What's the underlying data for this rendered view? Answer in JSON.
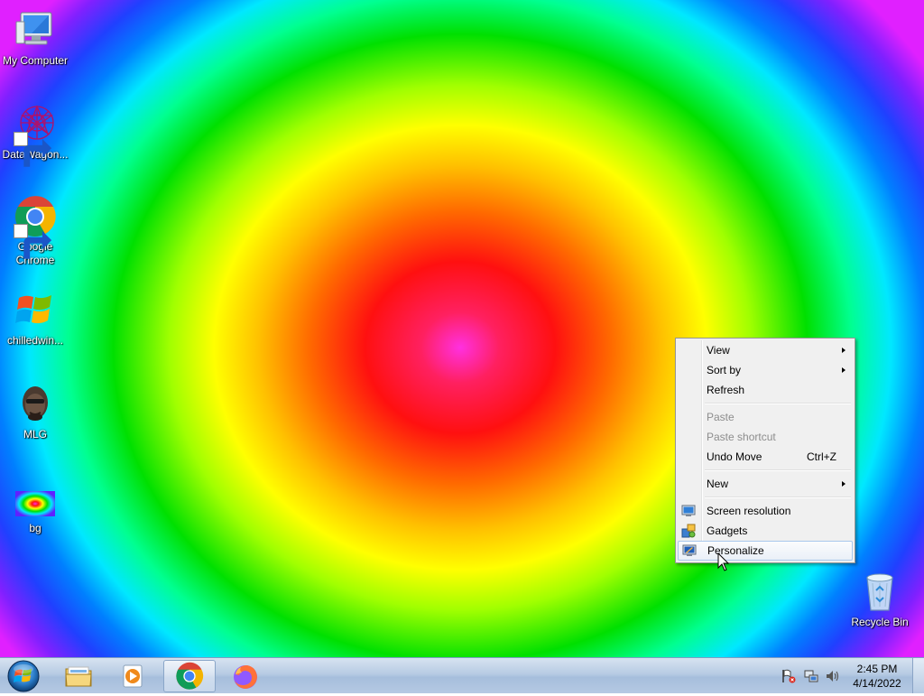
{
  "desktop_icons": [
    {
      "label": "My Computer",
      "icon": "computer-icon"
    },
    {
      "label": "DataWagon...",
      "icon": "datawagon-icon",
      "shortcut": true
    },
    {
      "label": "Google Chrome",
      "icon": "chrome-icon",
      "shortcut": true
    },
    {
      "label": "chilledwin...",
      "icon": "windows-logo-icon"
    },
    {
      "label": "MLG",
      "icon": "mlg-face-icon"
    },
    {
      "label": "bg",
      "icon": "bg-image-icon"
    },
    {
      "label": "Recycle Bin",
      "icon": "recycle-bin-icon"
    }
  ],
  "context_menu": {
    "items": [
      {
        "label": "View",
        "submenu": true
      },
      {
        "label": "Sort by",
        "submenu": true
      },
      {
        "label": "Refresh"
      },
      {
        "label": "Paste",
        "disabled": true
      },
      {
        "label": "Paste shortcut",
        "disabled": true
      },
      {
        "label": "Undo Move",
        "shortcut": "Ctrl+Z"
      },
      {
        "label": "New",
        "submenu": true
      },
      {
        "label": "Screen resolution",
        "icon": "screen-resolution-icon"
      },
      {
        "label": "Gadgets",
        "icon": "gadgets-icon"
      },
      {
        "label": "Personalize",
        "icon": "personalize-icon",
        "highlighted": true
      }
    ]
  },
  "taskbar": {
    "start_icon": "windows-start-orb-icon",
    "pinned": [
      {
        "name": "Windows Explorer",
        "icon": "folder-icon"
      },
      {
        "name": "Windows Media Player",
        "icon": "media-player-icon"
      },
      {
        "name": "Google Chrome",
        "icon": "chrome-icon",
        "active": true
      },
      {
        "name": "Firefox",
        "icon": "firefox-icon"
      }
    ],
    "tray_icons": [
      "action-center-flag-icon",
      "network-icon",
      "volume-icon"
    ],
    "clock": {
      "time": "2:45 PM",
      "date": "4/14/2022"
    }
  },
  "colors": {
    "taskbar": "#b7cbe3",
    "menu_background": "#f0f0f0",
    "menu_highlight_border": "#a8c8ec"
  }
}
